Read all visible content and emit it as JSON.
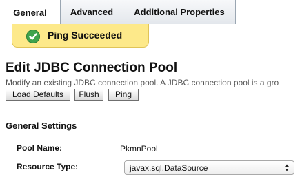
{
  "tabs": [
    {
      "label": "General",
      "active": true
    },
    {
      "label": "Advanced",
      "active": false
    },
    {
      "label": "Additional Properties",
      "active": false
    }
  ],
  "alert": {
    "message": "Ping Succeeded",
    "icon": "check-icon",
    "color": "#fde98a"
  },
  "page": {
    "title": "Edit JDBC Connection Pool",
    "description": "Modify an existing JDBC connection pool. A JDBC connection pool is a gro"
  },
  "buttons": {
    "load_defaults": "Load Defaults",
    "flush": "Flush",
    "ping": "Ping"
  },
  "section": {
    "title": "General Settings",
    "pool_name_label": "Pool Name:",
    "pool_name_value": "PkmnPool",
    "resource_type_label": "Resource Type:",
    "resource_type_value": "javax.sql.DataSource"
  }
}
